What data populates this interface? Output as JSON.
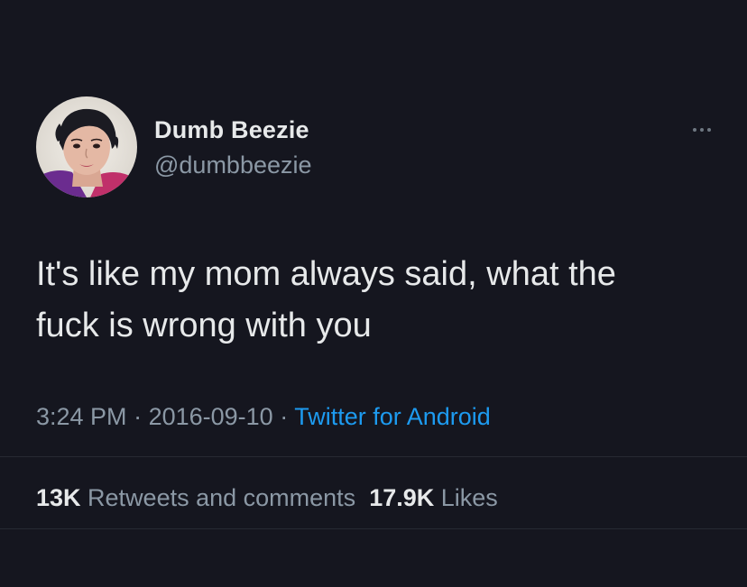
{
  "user": {
    "display_name": "Dumb Beezie",
    "handle": "@dumbbeezie"
  },
  "tweet": {
    "text": "It's like my mom always said, what the\nfuck is wrong with you",
    "time": "3:24 PM",
    "date": "2016-09-10",
    "separator": " · ",
    "source": "Twitter for Android"
  },
  "stats": {
    "retweets_count": "13K",
    "retweets_label": "Retweets and comments",
    "likes_count": "17.9K",
    "likes_label": "Likes"
  },
  "icons": {
    "more": "more-options-icon",
    "avatar": "profile-avatar"
  },
  "colors": {
    "background": "#15161f",
    "text": "#e7e9ea",
    "muted": "#8b98a5",
    "link": "#1d9bf0"
  }
}
